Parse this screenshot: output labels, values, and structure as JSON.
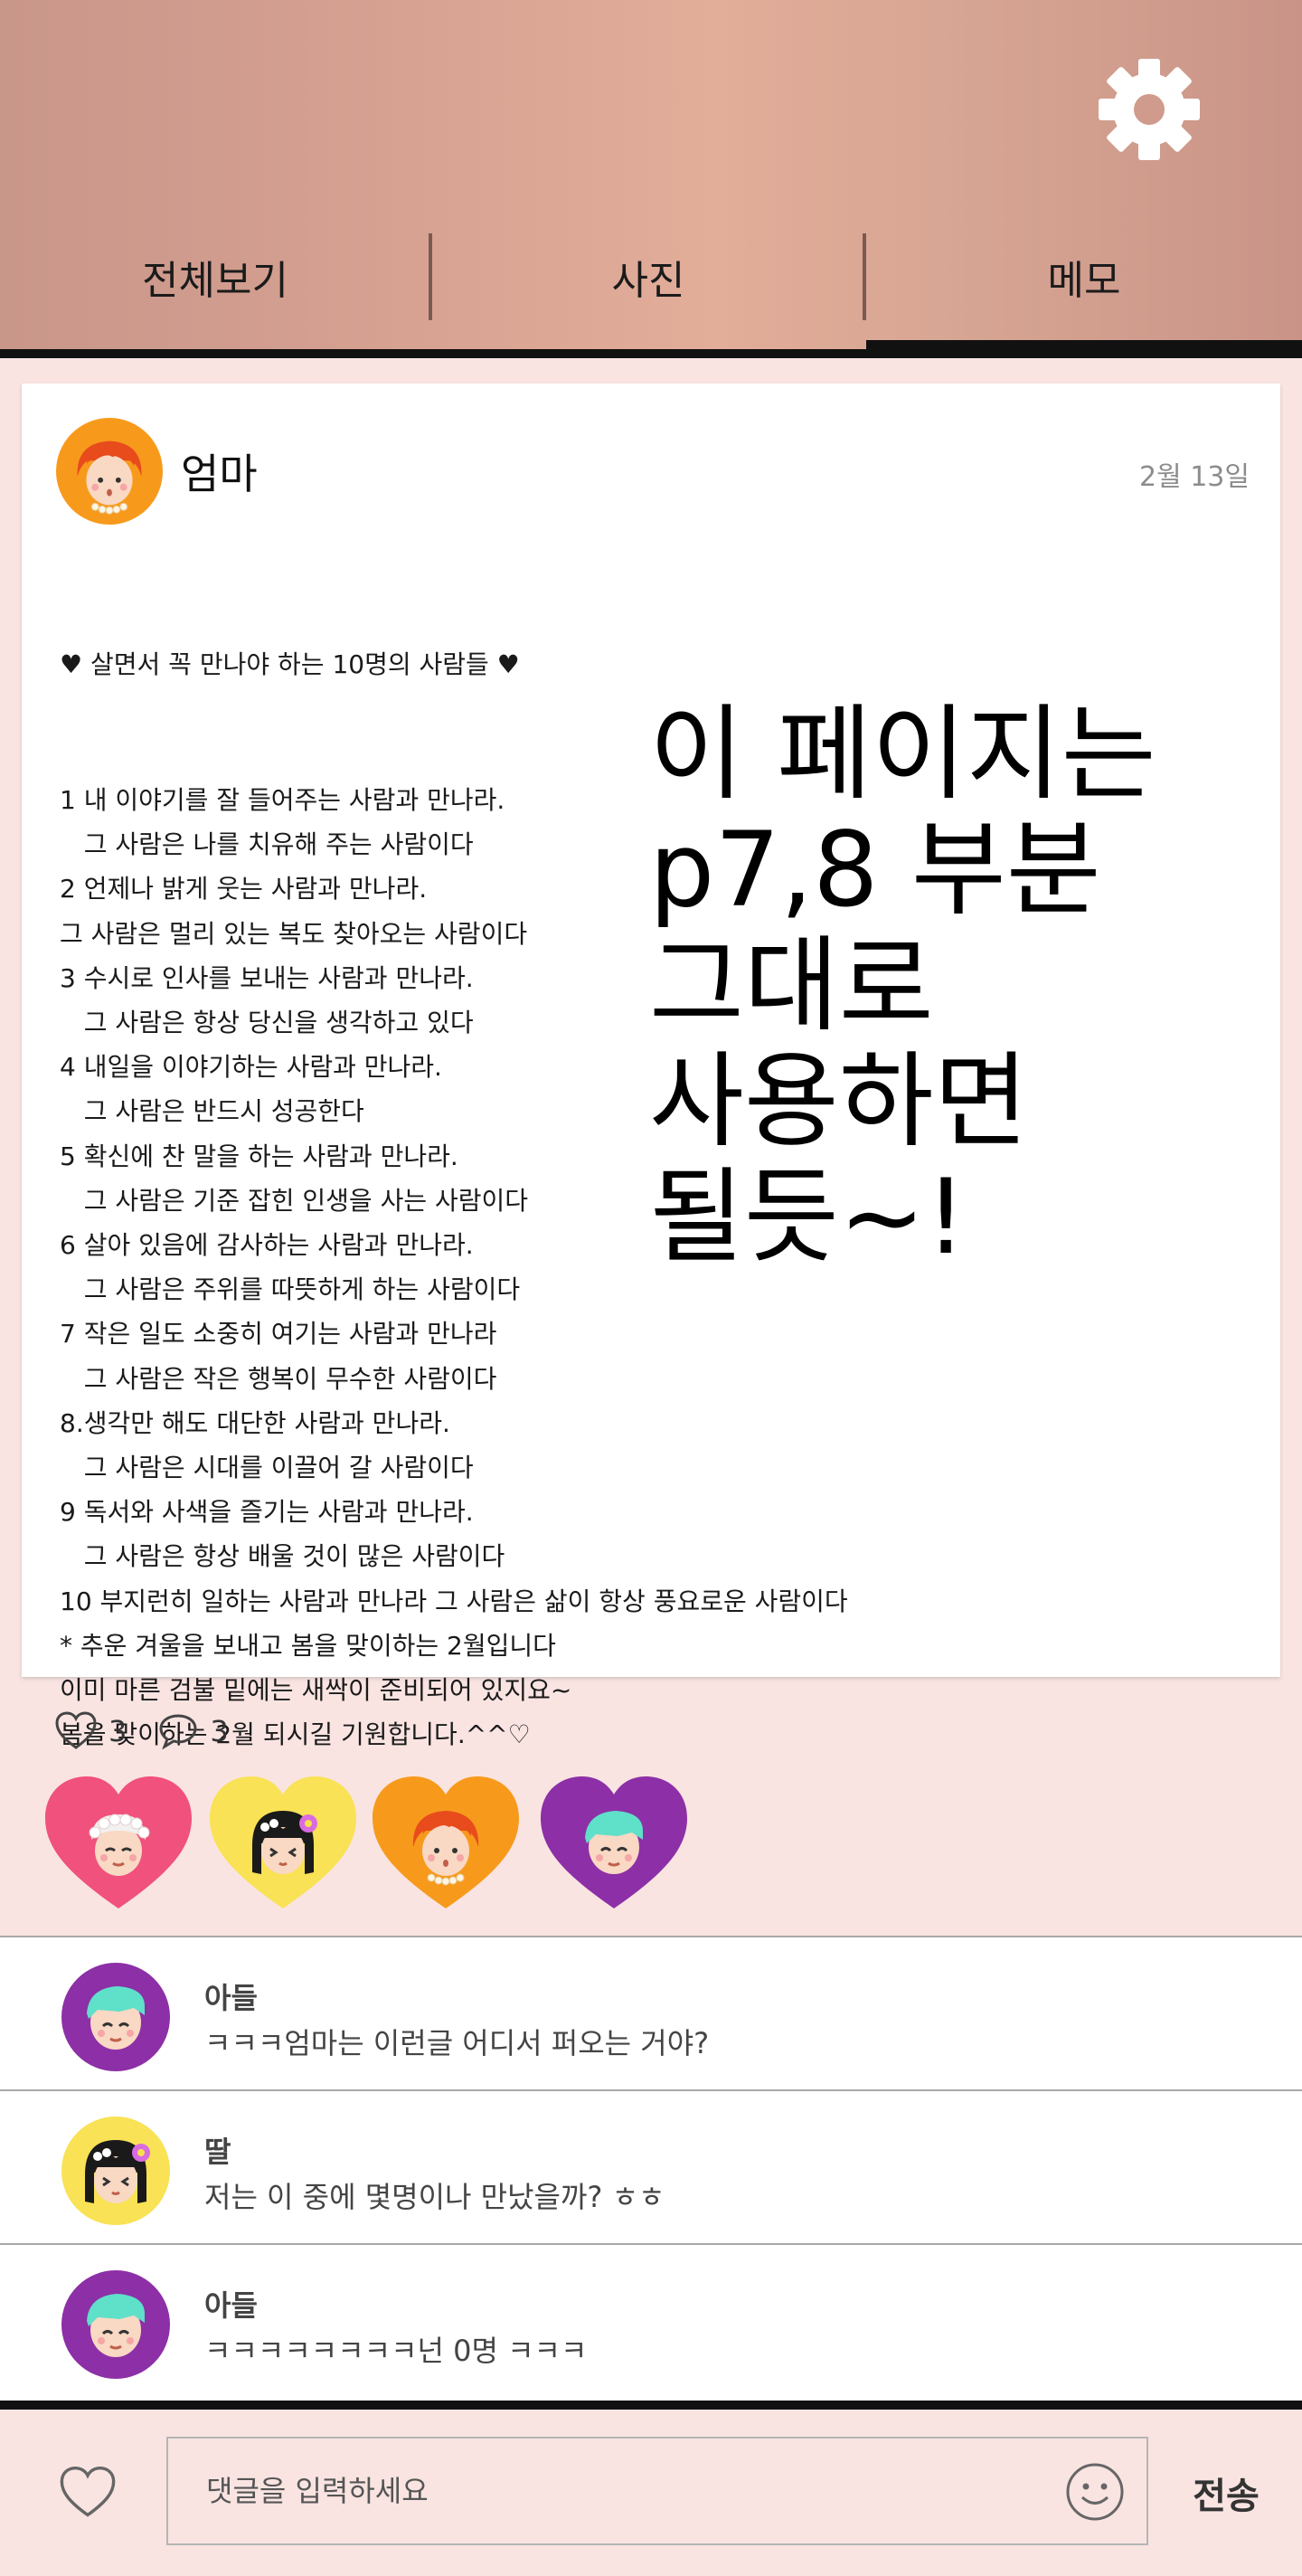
{
  "nav": {
    "icons": [
      "home-heart-icon",
      "photo-icon",
      "chat-heart-icon",
      "bell-icon",
      "gear-icon"
    ],
    "tabs": [
      {
        "label": "전체보기"
      },
      {
        "label": "사진"
      },
      {
        "label": "메모"
      }
    ],
    "active_tab": "메모"
  },
  "post": {
    "author": "엄마",
    "date": "2월 13일",
    "heading": "♥ 살면서 꼭 만나야 하는 10명의 사람들 ♥",
    "lines": [
      "1 내 이야기를 잘 들어주는 사람과 만나라.",
      "   그 사람은 나를 치유해 주는 사람이다",
      "2 언제나 밝게 웃는 사람과 만나라.",
      "그 사람은 멀리 있는 복도 찾아오는 사람이다",
      "3 수시로 인사를 보내는 사람과 만나라.",
      "   그 사람은 항상 당신을 생각하고 있다",
      "4 내일을 이야기하는 사람과 만나라.",
      "   그 사람은 반드시 성공한다",
      "5 확신에 찬 말을 하는 사람과 만나라.",
      "   그 사람은 기준 잡힌 인생을 사는 사람이다",
      "6 살아 있음에 감사하는 사람과 만나라.",
      "   그 사람은 주위를 따뜻하게 하는 사람이다",
      "7 작은 일도 소중히 여기는 사람과 만나라",
      "   그 사람은 작은 행복이 무수한 사람이다",
      "8.생각만 해도 대단한 사람과 만나라.",
      "   그 사람은 시대를 이끌어 갈 사람이다",
      "9 독서와 사색을 즐기는 사람과 만나라.",
      "   그 사람은 항상 배울 것이 많은 사람이다",
      "10 부지런히 일하는 사람과 만나라 그 사람은 삶이 항상 풍요로운 사람이다",
      "* 추운 겨울을 보내고 봄을 맞이하는 2월입니다",
      "이미 마른 검불 밑에는 새싹이 준비되어 있지요~",
      "봄을 맞이하는 2월 되시길 기원합니다.^^♡"
    ],
    "overlay_note": "이 페이지는\np7,8 부분\n그대로\n사용하면\n될듯~!"
  },
  "reactions": {
    "likes": "3",
    "comments": "3"
  },
  "reactors": [
    "grandma-avatar",
    "daughter-avatar",
    "mom-avatar",
    "son-avatar"
  ],
  "comments": [
    {
      "author": "아들",
      "text": "ㅋㅋㅋ엄마는 이런글 어디서 퍼오는 거야?",
      "avatar": "son-avatar"
    },
    {
      "author": "딸",
      "text": "저는 이 중에 몇명이나 만났을까? ㅎㅎ",
      "avatar": "daughter-avatar"
    },
    {
      "author": "아들",
      "text": "ㅋㅋㅋㅋㅋㅋㅋㅋ넌 0명 ㅋㅋㅋ",
      "avatar": "son-avatar"
    }
  ],
  "input": {
    "placeholder": "댓글을 입력하세요",
    "send_label": "전송"
  },
  "colors": {
    "header_gradient": [
      "#c9968a",
      "#e2ad99",
      "#c99487"
    ],
    "background": "#f9e4e2",
    "card": "#ffffff",
    "heart_pink": "#f0517d",
    "heart_yellow": "#f9e255",
    "heart_orange": "#f79a1c",
    "heart_purple": "#8d2fa6"
  }
}
